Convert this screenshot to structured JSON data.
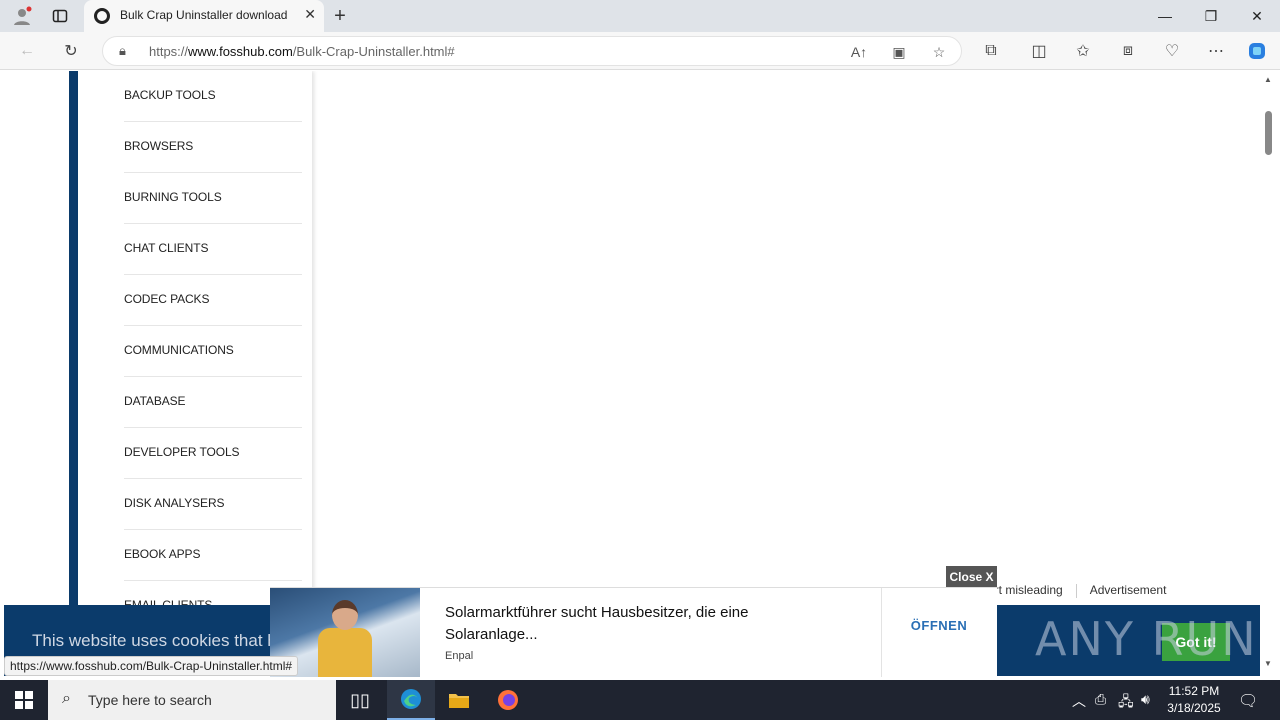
{
  "browser": {
    "tab_title": "Bulk Crap Uninstaller download",
    "url_prefix": "https://",
    "url_domain": "www.fosshub.com",
    "url_path": "/Bulk-Crap-Uninstaller.html#",
    "status_url": "https://www.fosshub.com/Bulk-Crap-Uninstaller.html#"
  },
  "sidebar": {
    "categories": [
      "BACKUP TOOLS",
      "BROWSERS",
      "BURNING TOOLS",
      "CHAT CLIENTS",
      "CODEC PACKS",
      "COMMUNICATIONS",
      "DATABASE",
      "DEVELOPER TOOLS",
      "DISK ANALYSERS",
      "EBOOK APPS",
      "EMAIL CLIENTS"
    ]
  },
  "cookie": {
    "message": "This website uses cookies that hel",
    "button": "Got it!"
  },
  "watermark": "ANY RUN",
  "ad": {
    "meta_report": "ort misleading",
    "meta_label": "Advertisement",
    "close": "Close X",
    "title": "Solarmarktführer sucht Hausbesitzer, die eine Solaranlage...",
    "source": "Enpal",
    "cta": "ÖFFNEN"
  },
  "taskbar": {
    "search_placeholder": "Type here to search",
    "time": "11:52 PM",
    "date": "3/18/2025"
  },
  "colors": {
    "sidebar_accent": "#0b3b6b",
    "cookie_bg": "#0b3b6b",
    "got_it_bg": "#3aa23f",
    "ad_cta": "#2a6fb5"
  }
}
